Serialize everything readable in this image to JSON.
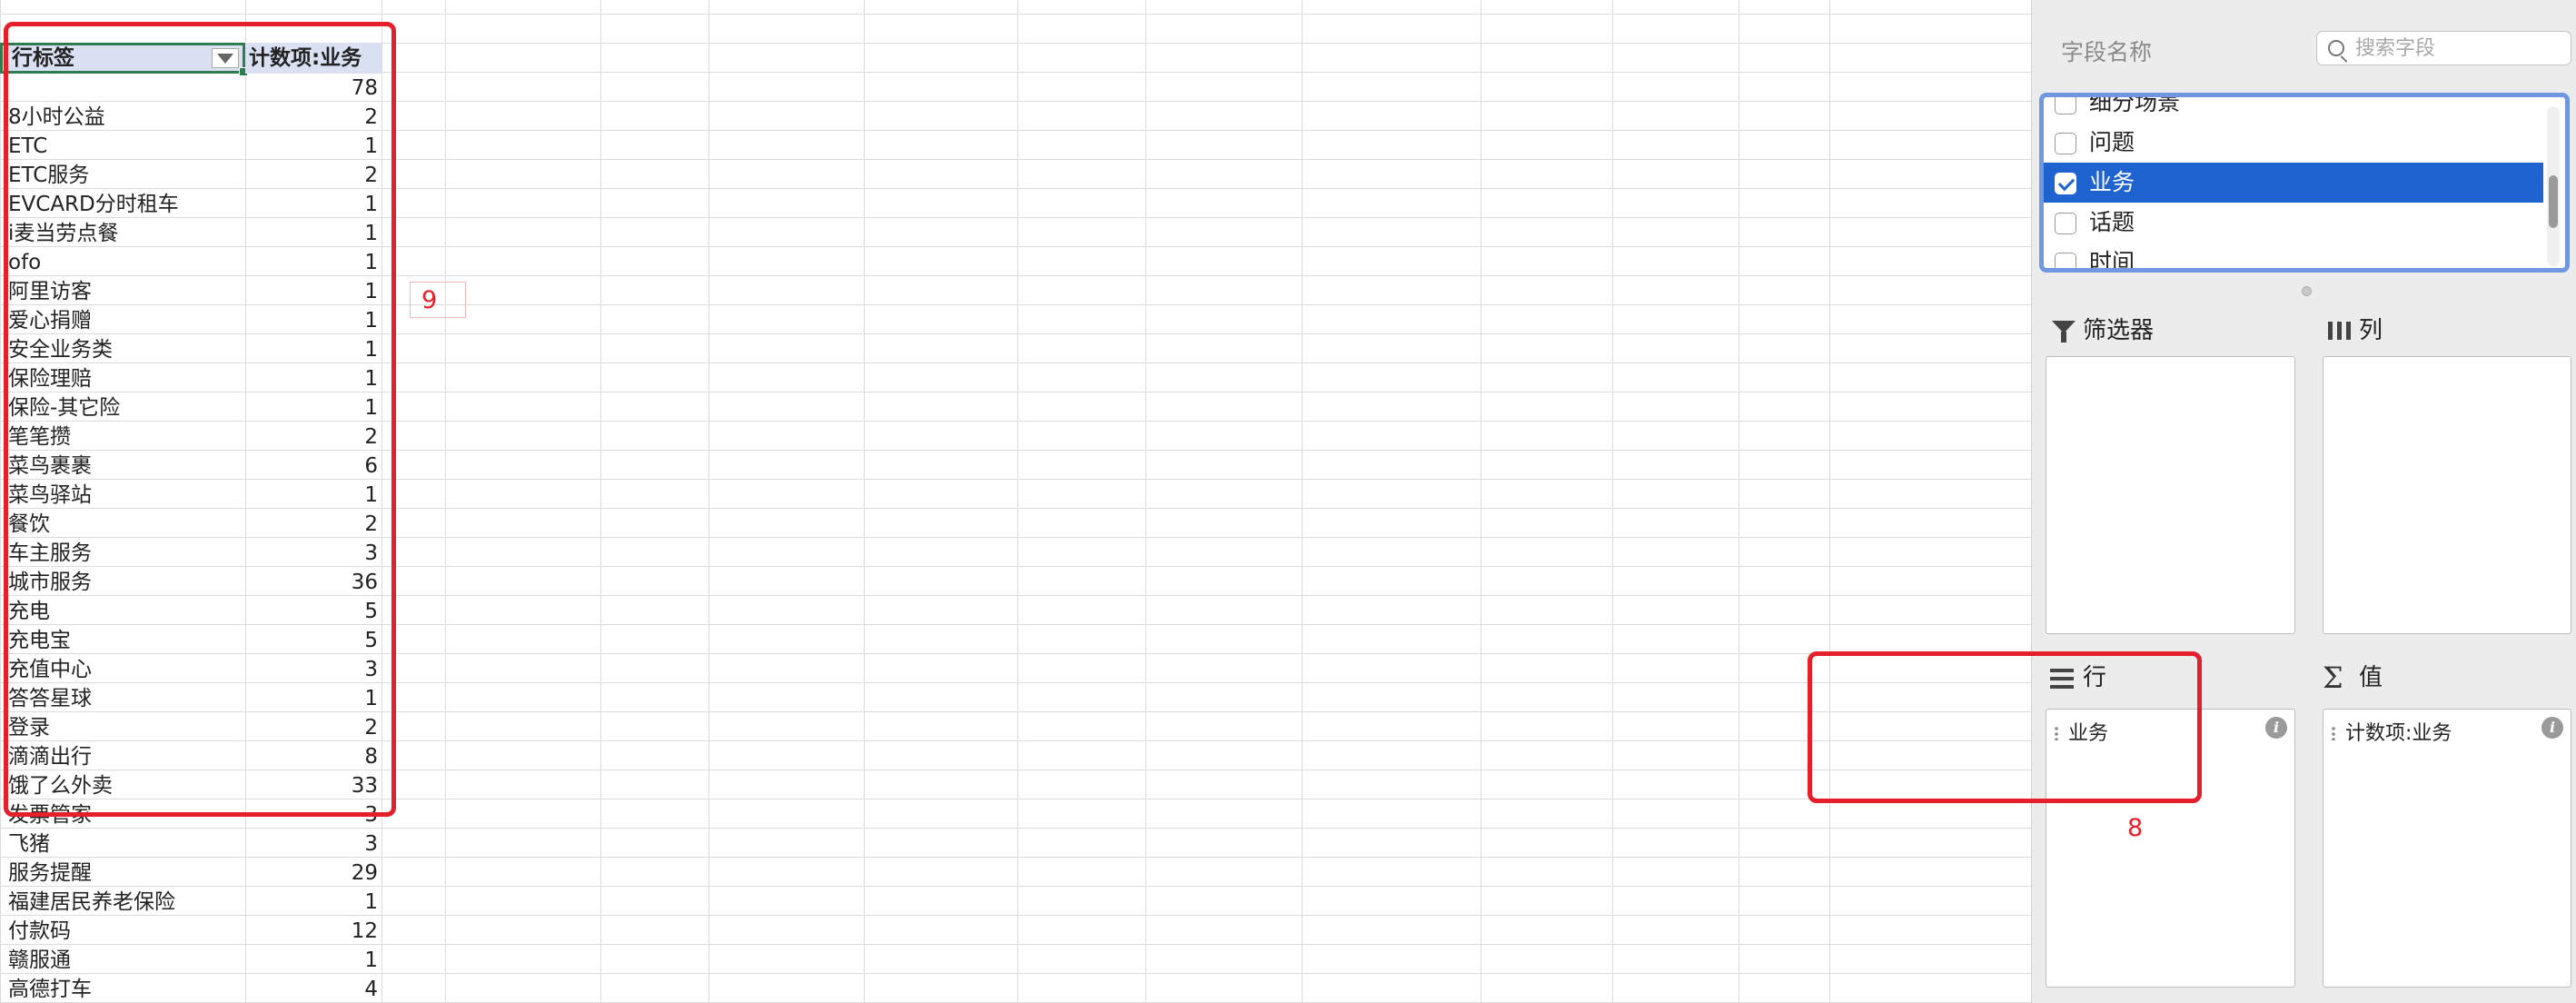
{
  "pivot_table": {
    "header_label": "行标签",
    "header_count": "计数项:业务",
    "rows": [
      {
        "label": "",
        "count": "78"
      },
      {
        "label": "8小时公益",
        "count": "2"
      },
      {
        "label": "ETC",
        "count": "1"
      },
      {
        "label": "ETC服务",
        "count": "2"
      },
      {
        "label": "EVCARD分时租车",
        "count": "1"
      },
      {
        "label": "i麦当劳点餐",
        "count": "1"
      },
      {
        "label": "ofo",
        "count": "1"
      },
      {
        "label": "阿里访客",
        "count": "1"
      },
      {
        "label": "爱心捐赠",
        "count": "1"
      },
      {
        "label": "安全业务类",
        "count": "1"
      },
      {
        "label": "保险理赔",
        "count": "1"
      },
      {
        "label": "保险-其它险",
        "count": "1"
      },
      {
        "label": "笔笔攒",
        "count": "2"
      },
      {
        "label": "菜鸟裹裹",
        "count": "6"
      },
      {
        "label": "菜鸟驿站",
        "count": "1"
      },
      {
        "label": "餐饮",
        "count": "2"
      },
      {
        "label": "车主服务",
        "count": "3"
      },
      {
        "label": "城市服务",
        "count": "36"
      },
      {
        "label": "充电",
        "count": "5"
      },
      {
        "label": "充电宝",
        "count": "5"
      },
      {
        "label": "充值中心",
        "count": "3"
      },
      {
        "label": "答答星球",
        "count": "1"
      },
      {
        "label": "登录",
        "count": "2"
      },
      {
        "label": "滴滴出行",
        "count": "8"
      },
      {
        "label": "饿了么外卖",
        "count": "33"
      },
      {
        "label": "发票管家",
        "count": "3"
      },
      {
        "label": "飞猪",
        "count": "3"
      },
      {
        "label": "服务提醒",
        "count": "29"
      },
      {
        "label": "福建居民养老保险",
        "count": "1"
      },
      {
        "label": "付款码",
        "count": "12"
      },
      {
        "label": "赣服通",
        "count": "1"
      },
      {
        "label": "高德打车",
        "count": "4"
      }
    ]
  },
  "annotations": {
    "left_number": "9",
    "right_number": "8"
  },
  "field_panel": {
    "title": "字段名称",
    "search_placeholder": "搜索字段",
    "fields": [
      {
        "label": "细分场景",
        "checked": false
      },
      {
        "label": "问题",
        "checked": false
      },
      {
        "label": "业务",
        "checked": true
      },
      {
        "label": "话题",
        "checked": false
      },
      {
        "label": "时间",
        "checked": false
      }
    ],
    "areas": {
      "filters": {
        "label": "筛选器",
        "icon": "funnel-icon"
      },
      "columns": {
        "label": "列",
        "icon": "columns-icon"
      },
      "rows": {
        "label": "行",
        "icon": "rows-icon",
        "item": "业务"
      },
      "values": {
        "label": "值",
        "icon": "sigma-icon",
        "item": "计数项:业务"
      }
    }
  },
  "colors": {
    "annotation_red": "#e5202a",
    "selection_blue": "#1f63d0",
    "header_fill": "#d9e1f2",
    "active_cell_green": "#2e7d4f"
  }
}
